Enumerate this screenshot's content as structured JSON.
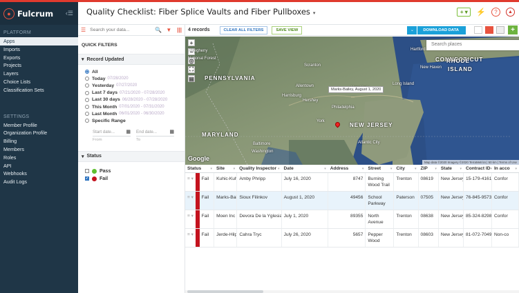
{
  "sidebar": {
    "brand": "Fulcrum",
    "collapse_icon": "collapse-icon",
    "platform_heading": "PLATFORM",
    "platform_items": [
      "Apps",
      "Imports",
      "Exports",
      "Projects",
      "Layers",
      "Choice Lists",
      "Classification Sets"
    ],
    "settings_heading": "SETTINGS",
    "settings_items": [
      "Member Profile",
      "Organization Profile",
      "Billing",
      "Members",
      "Roles",
      "API",
      "Webhooks",
      "Audit Logs"
    ],
    "active_item": "Apps"
  },
  "topbar": {
    "title": "Quality Checklist: Fiber Splice Vaults and Fiber Pullboxes",
    "caret": "▾",
    "plus_label": "+ ▾",
    "bolt": "⚡",
    "help": "?",
    "up": "▲"
  },
  "filters": {
    "search_placeholder": "Search your data...",
    "quick_filters": "QUICK FILTERS",
    "record_updated": {
      "heading": "Record Updated",
      "options": [
        {
          "label": "All",
          "date": "",
          "selected": true
        },
        {
          "label": "Today",
          "date": "07/28/2020",
          "selected": false
        },
        {
          "label": "Yesterday",
          "date": "07/27/2020",
          "selected": false
        },
        {
          "label": "Last 7 days",
          "date": "07/21/2020 - 07/28/2020",
          "selected": false
        },
        {
          "label": "Last 30 days",
          "date": "06/28/2020 - 07/28/2020",
          "selected": false
        },
        {
          "label": "This Month",
          "date": "07/01/2020 - 07/31/2020",
          "selected": false
        },
        {
          "label": "Last Month",
          "date": "06/01/2020 - 06/30/2020",
          "selected": false
        },
        {
          "label": "Specific Range",
          "date": "",
          "selected": false
        }
      ],
      "start_placeholder": "Start date...",
      "end_placeholder": "End date...",
      "from_label": "From",
      "to_label": "To"
    },
    "status": {
      "heading": "Status",
      "options": [
        {
          "label": "Pass",
          "color": "#5fbf2f",
          "checked": false
        },
        {
          "label": "Fail",
          "color": "#c4131e",
          "checked": true
        }
      ]
    }
  },
  "toolbar": {
    "record_count": "4 records",
    "clear_filters": "CLEAR ALL FILTERS",
    "save_view": "SAVE VIEW",
    "download_caret": "⌄",
    "download": "DOWNLOAD DATA",
    "add": "+"
  },
  "map": {
    "search_placeholder": "Search places",
    "labels": [
      "Allegheny",
      "National Forest",
      "Scranton",
      "Hartford",
      "CONNECTICUT",
      "RHODE",
      "ISLAND",
      "New Haven",
      "PENNSYLVANIA",
      "Allentown",
      "New York",
      "Long Island",
      "Harrisburg",
      "Hershey",
      "Philadelphia",
      "York",
      "NEW JERSEY",
      "MARYLAND",
      "Baltimore",
      "Washington",
      "Atlantic City"
    ],
    "callout": "Marks-Bailey, August 1, 2020",
    "google": "Google",
    "attribution": "Map data ©2020 Imagery ©2020 TerraMetrics | 50 km | Terms of Use"
  },
  "table": {
    "columns": [
      "Status",
      "Site",
      "Quality Inspector",
      "Date",
      "Address",
      "Street",
      "City",
      "ZIP",
      "State",
      "Contract ID",
      "In acco"
    ],
    "rows": [
      [
        "Fail",
        "Kuhic-Kuhic",
        "Amby Phripp",
        "July 16, 2020",
        "8747",
        "Burning Wood Trail",
        "Trenton",
        "08619",
        "New Jersey",
        "15-179-4161",
        "Confor"
      ],
      [
        "Fail",
        "Marks-Bailey",
        "Sioux Filinkov",
        "August 1, 2020",
        "49456",
        "School Parkway",
        "Paterson",
        "07505",
        "New Jersey",
        "76-845-9573",
        "Confor"
      ],
      [
        "Fail",
        "Moen Inc",
        "Devora De la Yglesia",
        "July 1, 2020",
        "89355",
        "North Avenue",
        "Trenton",
        "08638",
        "New Jersey",
        "85-324-8298",
        "Confor"
      ],
      [
        "Fail",
        "Jerde-Hilpert",
        "Cahra Tryc",
        "July 26, 2020",
        "5657",
        "Pepper Wood",
        "Trenton",
        "08603",
        "New Jersey",
        "81-072-7049",
        "Non-co"
      ]
    ],
    "selected_row": 1,
    "status_color": "#c4131e"
  }
}
